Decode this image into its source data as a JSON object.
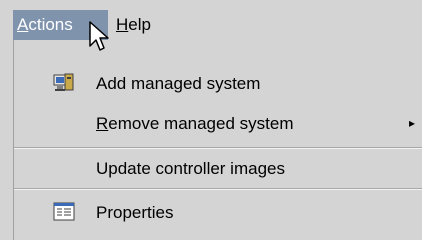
{
  "menubar": {
    "actions": {
      "mnemonic": "A",
      "rest": "ctions"
    },
    "help": {
      "mnemonic": "H",
      "rest": "elp"
    }
  },
  "menu": {
    "items": [
      {
        "text": "Add managed system",
        "icon": "managed-system-icon"
      },
      {
        "mnemonic": "R",
        "rest": "emove managed system",
        "submenu_indicator": "▸"
      },
      {
        "text": "Update controller images"
      },
      {
        "text": "Properties",
        "icon": "properties-icon"
      }
    ]
  },
  "colors": {
    "menu_background": "#d4d4d4",
    "active_highlight": "#7f93ad"
  }
}
